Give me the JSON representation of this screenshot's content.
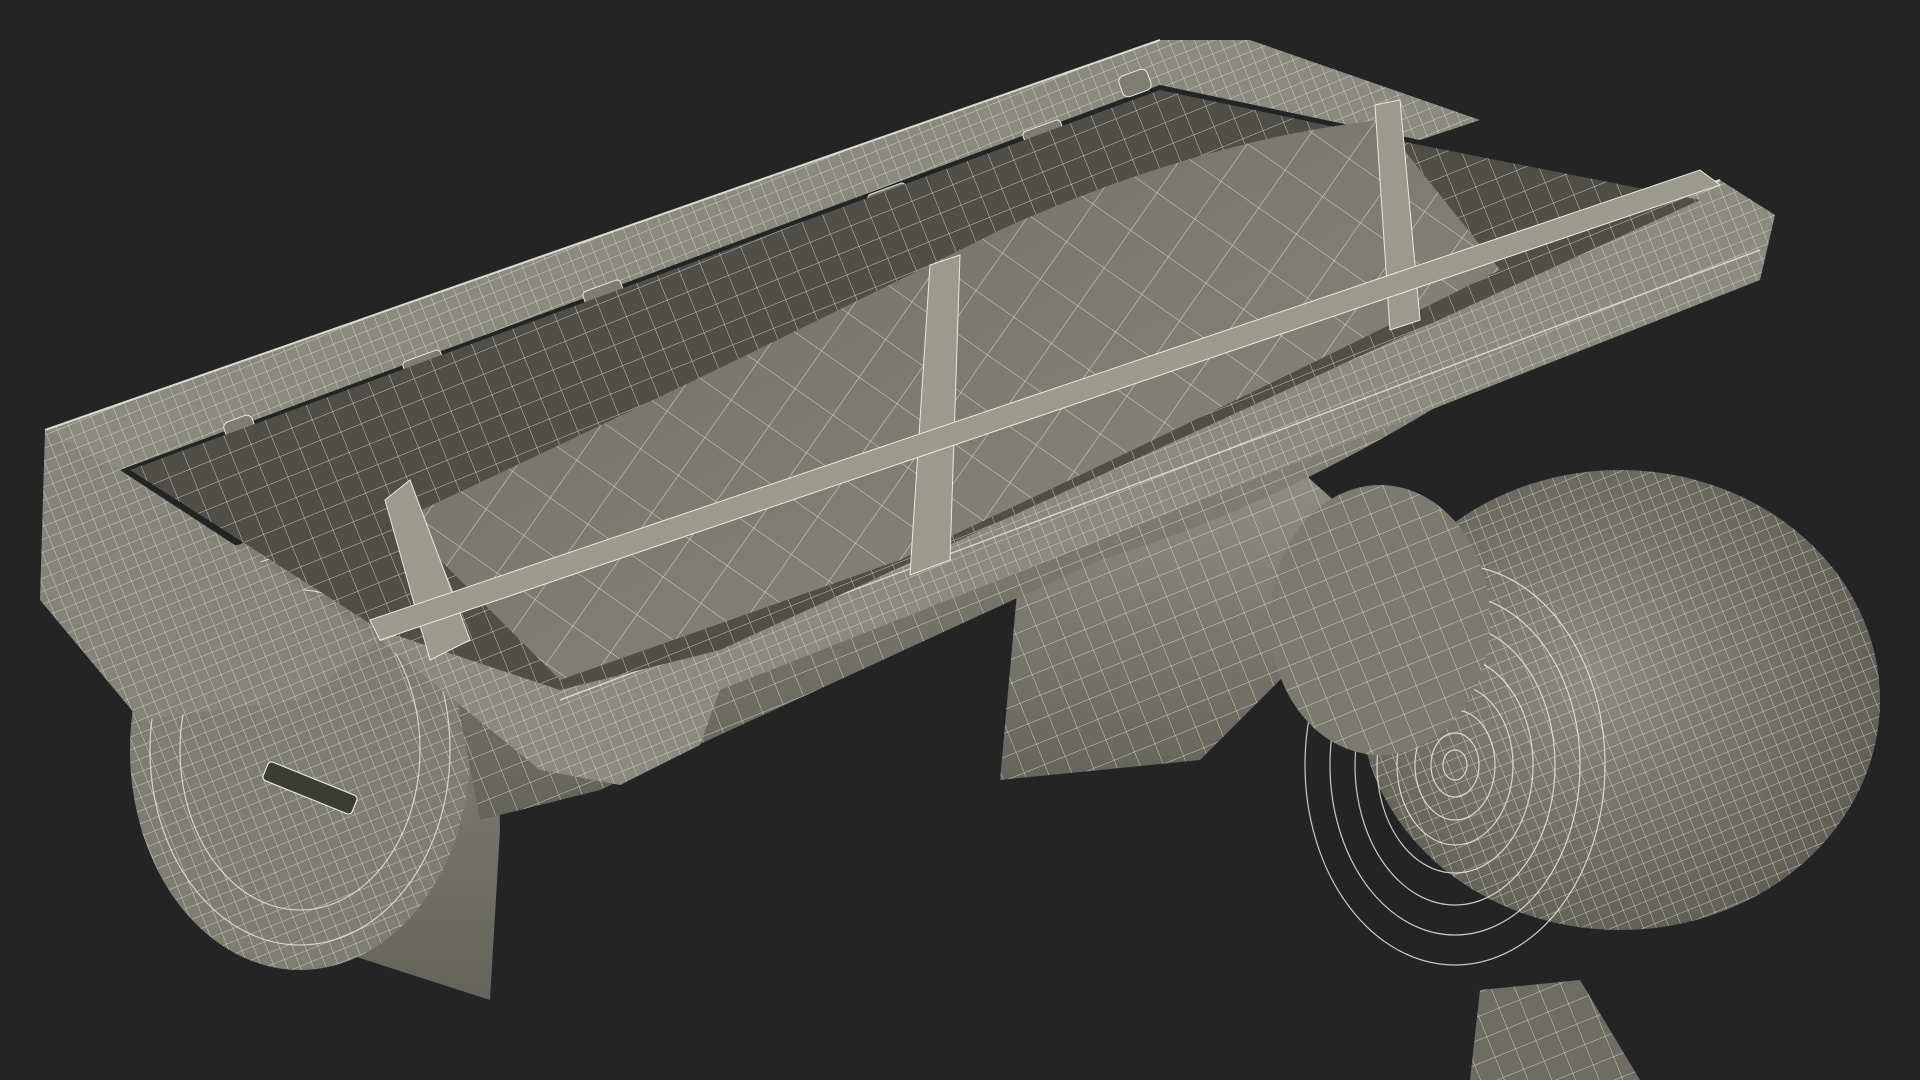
{
  "scene": {
    "subject": "vacuum-cleaner-brush-head-wireframe",
    "background_color": "#242424",
    "surface_color": "#7d7d72",
    "surface_shadow_color": "#5e5e55",
    "surface_highlight_color": "#9a9a8d",
    "wire_color": "#e9e9dc"
  }
}
